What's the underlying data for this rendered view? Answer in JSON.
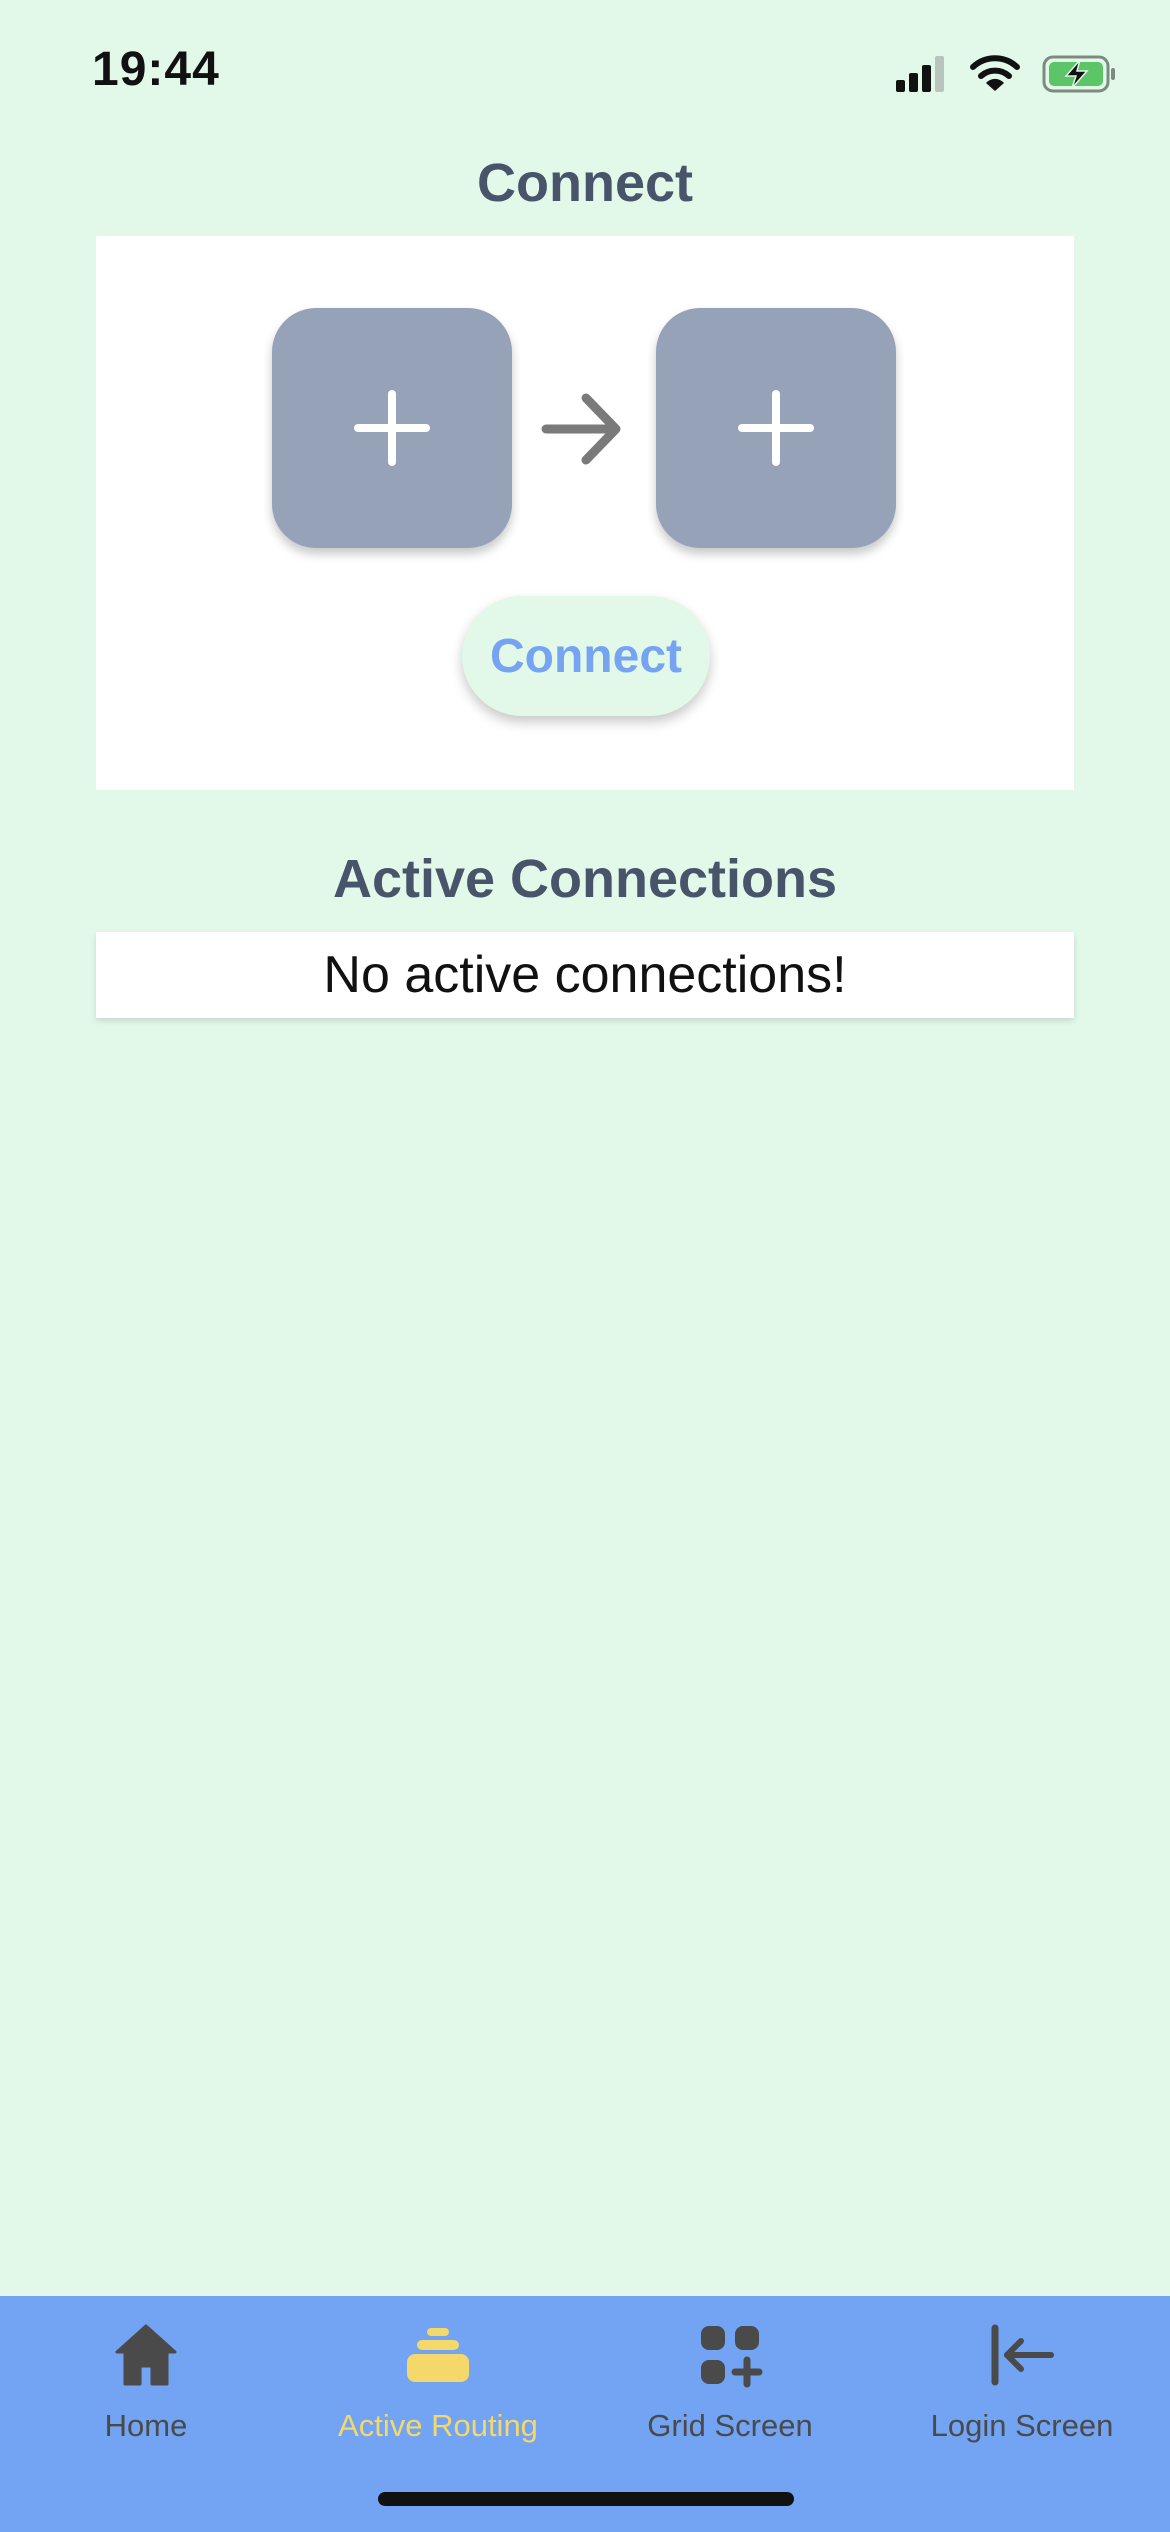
{
  "status_bar": {
    "time": "19:44",
    "icons": [
      "cellular-signal-icon",
      "wifi-icon",
      "battery-charging-icon"
    ]
  },
  "connect_section": {
    "title": "Connect",
    "source_slot_icon": "plus-icon",
    "target_slot_icon": "plus-icon",
    "arrow_icon": "arrow-right-icon",
    "connect_button_label": "Connect"
  },
  "active_connections": {
    "title": "Active Connections",
    "empty_message": "No active connections!"
  },
  "tab_bar": {
    "items": [
      {
        "label": "Home",
        "icon": "home-icon",
        "active": false
      },
      {
        "label": "Active Routing",
        "icon": "stack-icon",
        "active": true
      },
      {
        "label": "Grid Screen",
        "icon": "grid-add-icon",
        "active": false
      },
      {
        "label": "Login Screen",
        "icon": "arrow-left-to-line-icon",
        "active": false
      }
    ]
  },
  "colors": {
    "background": "#e2f8e8",
    "card": "#ffffff",
    "slot": "#96a2b8",
    "title_text": "#47546a",
    "button_text": "#76a4f2",
    "tab_bar": "#73a3f3",
    "tab_active": "#f4d86a",
    "tab_inactive": "#4a4a4a"
  }
}
